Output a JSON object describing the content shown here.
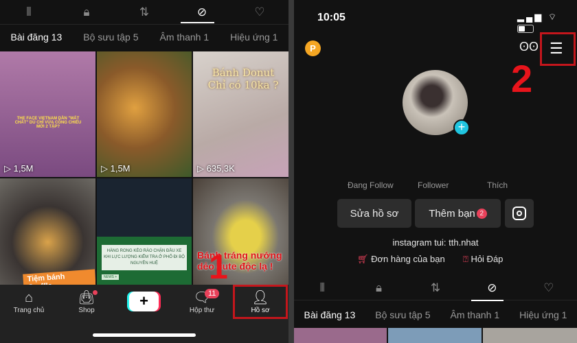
{
  "left": {
    "icon_tabs": [
      {
        "icon": "grid-icon"
      },
      {
        "icon": "lock-icon"
      },
      {
        "icon": "repost-icon"
      },
      {
        "icon": "bookmark-tag-icon",
        "active": true
      },
      {
        "icon": "liked-heart-icon"
      }
    ],
    "text_tabs": [
      "Bài đăng 13",
      "Bộ sưu tập 5",
      "Âm thanh 1",
      "Hiệu ứng 1"
    ],
    "videos": [
      {
        "views": "1,5M",
        "caption": "THE FACE VIETNAM DẦN \"MẤT CHẤT\" DÙ CHỈ VỪA CÔNG CHIẾU MỚI 2 TẬP?",
        "bg": "#9a5a8c"
      },
      {
        "views": "1,5M",
        "caption": "",
        "bg": "#8a6a3a"
      },
      {
        "views": "635,3K",
        "caption": "Bánh Donut Chỉ có 10ka ?",
        "bg": "#bdb6b0"
      },
      {
        "views": "",
        "caption": "Tiệm bánh Croffle",
        "bg": "#6a6460"
      },
      {
        "views": "",
        "caption": "HÀNG RONG KÉO RÀO CHẶN ĐẦU XE KHI LỰC LƯỢNG KIỂM TRA Ở PHỐ ĐI BỘ NGUYỄN HUỆ",
        "tag": "NEWS +",
        "bg": "#1d6b34"
      },
      {
        "views": "",
        "caption": "Bánh tráng nướng dẻo cute độc lạ !",
        "bg": "#8d8270"
      }
    ],
    "nav": [
      {
        "label": "Trang chủ",
        "icon": "home-icon"
      },
      {
        "label": "Shop",
        "icon": "shop-bag-icon"
      },
      {
        "label": "",
        "icon": "create-plus-icon"
      },
      {
        "label": "Hộp thư",
        "icon": "inbox-icon",
        "badge": "11"
      },
      {
        "label": "Hồ sơ",
        "icon": "profile-icon",
        "active": true
      }
    ],
    "step_number": "1"
  },
  "right": {
    "status": {
      "time": "10:05"
    },
    "coin_label": "P",
    "step_number": "2",
    "stats": [
      "Đang Follow",
      "Follower",
      "Thích"
    ],
    "buttons": {
      "edit": "Sửa hồ sơ",
      "add_friend": "Thêm bạn",
      "add_friend_badge": "2"
    },
    "bio": "instagram tui: tth.nhat",
    "links": {
      "orders": "Đơn hàng của bạn",
      "faq": "Hỏi Đáp"
    },
    "text_tabs": [
      "Bài đăng 13",
      "Bộ sưu tập 5",
      "Âm thanh 1",
      "Hiệu ứng 1"
    ]
  },
  "colors": {
    "accent_red": "#e8141b",
    "badge": "#e8415a",
    "bg": "#121212"
  }
}
